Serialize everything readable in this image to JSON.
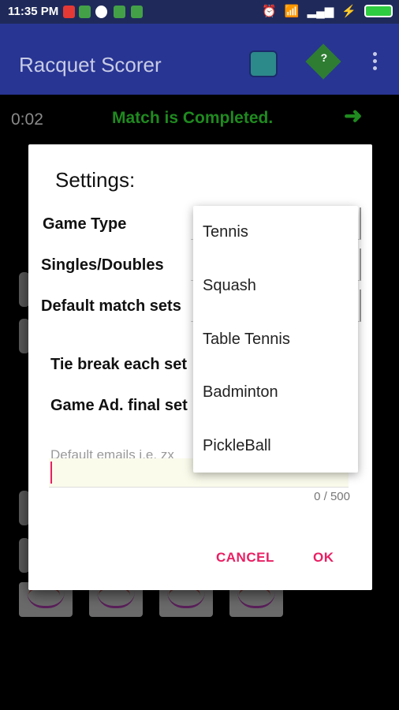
{
  "status_bar": {
    "time": "11:35 PM"
  },
  "app_bar": {
    "title": "Racquet Scorer"
  },
  "scoreboard": {
    "timer": "0:02",
    "status": "Match is Completed."
  },
  "dialog": {
    "title": "Settings:",
    "labels": {
      "game_type": "Game Type",
      "singles_doubles": "Singles/Doubles",
      "default_sets": "Default match sets",
      "tie_break": "Tie break each set",
      "game_ad": "Game Ad. final set"
    },
    "email_placeholder": "Default emails i.e. zx",
    "counter": "0 / 500",
    "buttons": {
      "cancel": "CANCEL",
      "ok": "OK"
    }
  },
  "dropdown": {
    "options": [
      "Tennis",
      "Squash",
      "Table Tennis",
      "Badminton",
      "PickleBall"
    ]
  },
  "colors": {
    "accent": "#e91e63",
    "app_bar": "#283593",
    "status_green": "#1f8a1f"
  }
}
